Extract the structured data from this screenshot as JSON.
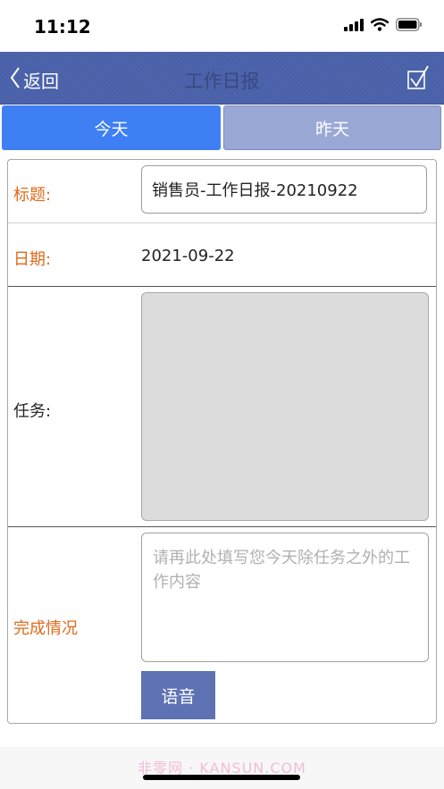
{
  "status_bar": {
    "time": "11:12"
  },
  "navbar": {
    "back_label": "返回",
    "title": "工作日报"
  },
  "tabs": [
    {
      "label": "今天",
      "active": true
    },
    {
      "label": "昨天",
      "active": false
    }
  ],
  "form": {
    "title_label": "标题:",
    "title_value": "销售员-工作日报-20210922",
    "date_label": "日期:",
    "date_value": "2021-09-22",
    "task_label": "任务:",
    "complete_label": "完成情况",
    "complete_placeholder": "请再此处填写您今天除任务之外的工作内容",
    "voice_button": "语音"
  },
  "watermark": "非零网 · KANSUN.COM",
  "colors": {
    "navbar": "#4c64ac",
    "tab_active": "#3e7ff3",
    "tab_inactive": "#9aa8d6",
    "label_orange": "#e06a1a",
    "voice_button": "#5e72b3"
  },
  "icons": [
    "signal-icon",
    "wifi-icon",
    "battery-icon",
    "back-chevron-icon",
    "checkbox-check-icon"
  ]
}
